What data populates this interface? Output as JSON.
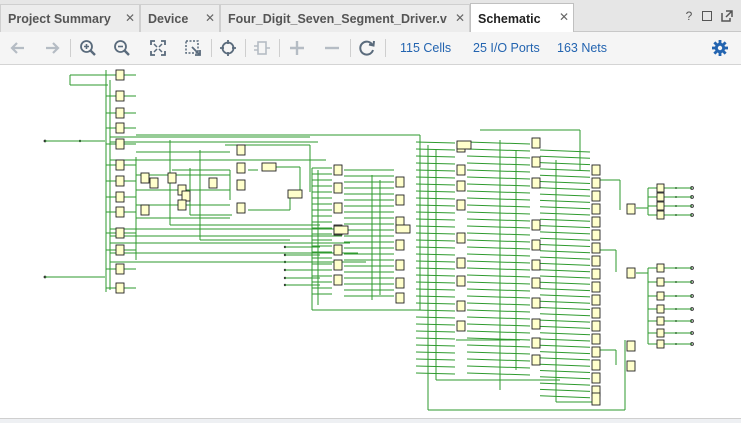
{
  "tabs": [
    {
      "label": "Project Summary",
      "close": "✕"
    },
    {
      "label": "Device",
      "close": "✕"
    },
    {
      "label": "Four_Digit_Seven_Segment_Driver.v",
      "close": "✕"
    },
    {
      "label": "Schematic",
      "close": "✕"
    }
  ],
  "active_tab": "Schematic",
  "window_controls": {
    "help": "?"
  },
  "toolbar": {
    "icons": [
      "back-arrow-icon",
      "forward-arrow-icon",
      "zoom-in-icon",
      "zoom-out-icon",
      "fit-view-icon",
      "zoom-area-icon",
      "autofit-selection-icon",
      "regenerate-icon",
      "expand-icon",
      "collapse-icon",
      "reload-icon",
      "settings-gear-icon"
    ],
    "cells_link": "115 Cells",
    "ports_link": "25 I/O Ports",
    "nets_link": "163 Nets"
  },
  "colors": {
    "wire": "#2e9a2e",
    "cell_fill": "#ffffcc",
    "cell_stroke": "#222222",
    "link": "#2364b0",
    "icon": "#5a6b7c",
    "icon_disabled": "#b5bcc4"
  }
}
